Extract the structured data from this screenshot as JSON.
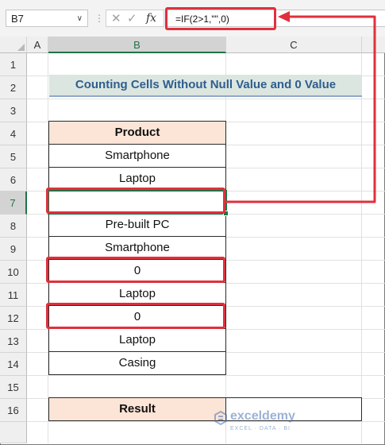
{
  "formula_bar": {
    "name_box": "B7",
    "dropdown_glyph": "∨",
    "separator": "⋮",
    "cancel_glyph": "✕",
    "enter_glyph": "✓",
    "fx_label": "fx",
    "formula": "=IF(2>1,\"\",0)"
  },
  "columns": [
    "A",
    "B",
    "C"
  ],
  "rows": [
    "1",
    "2",
    "3",
    "4",
    "5",
    "6",
    "7",
    "8",
    "9",
    "10",
    "11",
    "12",
    "13",
    "14",
    "15",
    "16"
  ],
  "selected_row": "7",
  "selected_column": "B",
  "title": "Counting Cells Without Null Value and 0 Value",
  "table": {
    "header": "Product",
    "items": [
      "Smartphone",
      "Laptop",
      "",
      "Pre-built PC",
      "Smartphone",
      "0",
      "Laptop",
      "0",
      "Laptop",
      "Casing"
    ]
  },
  "result": {
    "label": "Result",
    "value": ""
  },
  "watermark": {
    "brand": "exceldemy",
    "tagline": "EXCEL · DATA · BI"
  },
  "colors": {
    "highlight": "#e0303c",
    "selection": "#217346",
    "header_fill": "#fce4d6",
    "title_fill": "#dce6e0",
    "title_text": "#2e5e8e"
  }
}
